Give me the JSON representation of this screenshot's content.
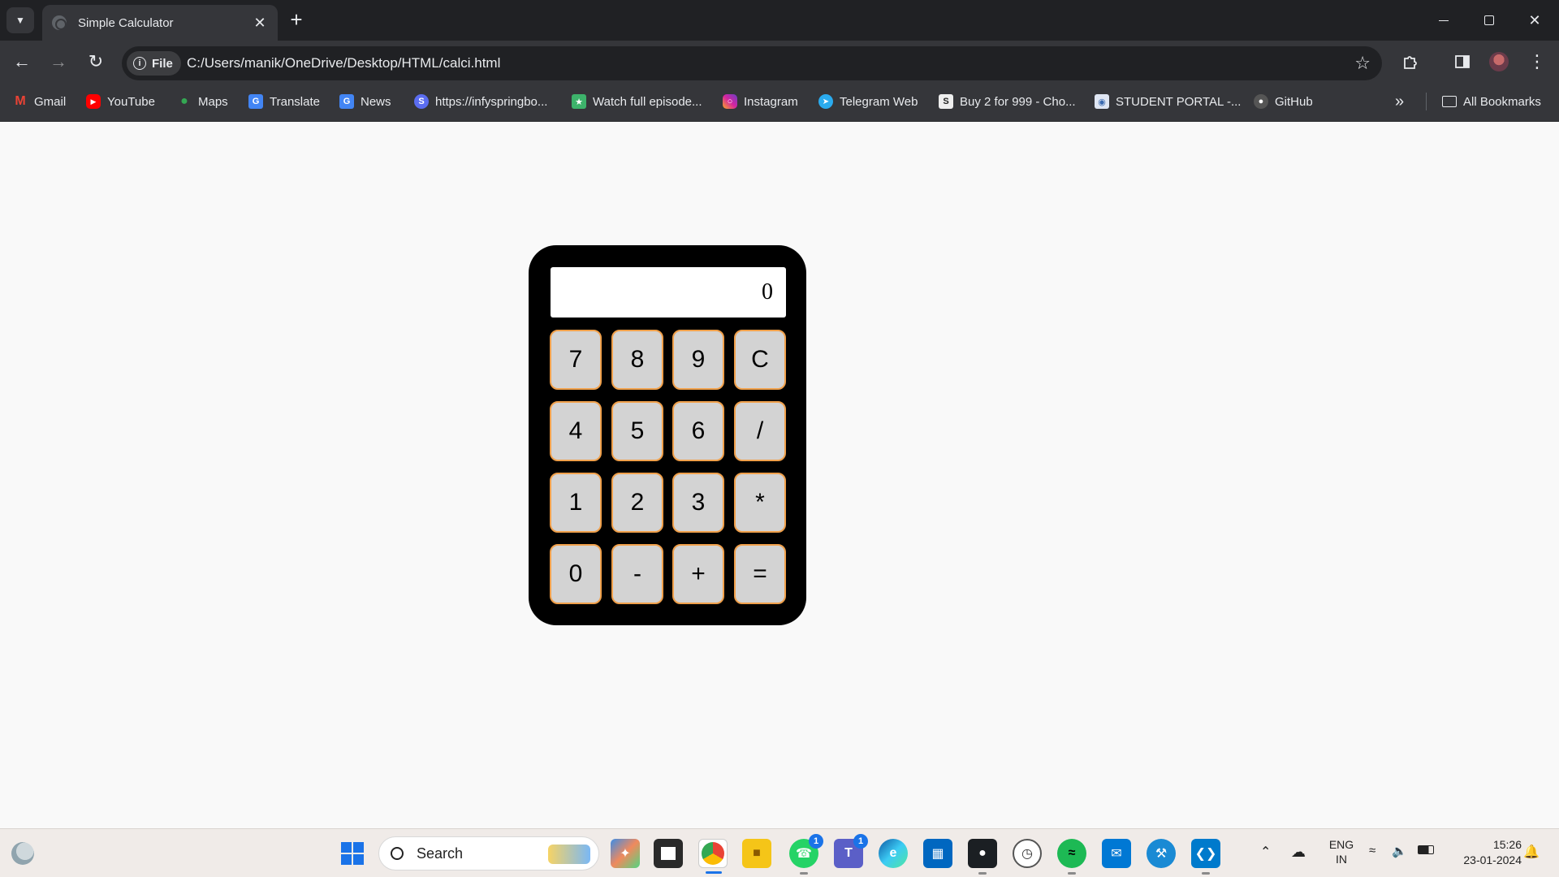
{
  "browser": {
    "tab_title": "Simple Calculator",
    "chip_label": "File",
    "url": "C:/Users/manik/OneDrive/Desktop/HTML/calci.html",
    "bookmarks": [
      {
        "label": "Gmail",
        "icon": "gmail-icon",
        "color": "#ea4335"
      },
      {
        "label": "YouTube",
        "icon": "youtube-icon",
        "color": "#ff0000"
      },
      {
        "label": "Maps",
        "icon": "maps-pin-icon",
        "color": "#34a853"
      },
      {
        "label": "Translate",
        "icon": "translate-icon",
        "color": "#4285f4"
      },
      {
        "label": "News",
        "icon": "news-icon",
        "color": "#4285f4"
      },
      {
        "label": "https://infyspringbo...",
        "icon": "infy-icon",
        "color": "#5b6df0"
      },
      {
        "label": "Watch full episode...",
        "icon": "hotstar-icon",
        "color": "#3db36b"
      },
      {
        "label": "Instagram",
        "icon": "instagram-icon",
        "color": "#d6249f"
      },
      {
        "label": "Telegram Web",
        "icon": "telegram-icon",
        "color": "#2aabee"
      },
      {
        "label": "Buy 2 for 999 - Cho...",
        "icon": "shop-icon",
        "color": "#444444"
      },
      {
        "label": "STUDENT PORTAL -...",
        "icon": "portal-icon",
        "color": "#3a6ab0"
      },
      {
        "label": "GitHub",
        "icon": "github-icon",
        "color": "#555555"
      }
    ],
    "all_bookmarks_label": "All Bookmarks"
  },
  "calculator": {
    "display_value": "0",
    "keys": [
      "7",
      "8",
      "9",
      "C",
      "4",
      "5",
      "6",
      "/",
      "1",
      "2",
      "3",
      "*",
      "0",
      "-",
      "+",
      "="
    ]
  },
  "taskbar": {
    "search_label": "Search",
    "whatsapp_badge": "1",
    "teams_badge": "1",
    "lang_top": "ENG",
    "lang_bottom": "IN",
    "time": "15:26",
    "date": "23-01-2024"
  },
  "colors": {
    "calc_body": "#000000",
    "key_fill": "#d3d3d3",
    "key_border": "#f0a04b"
  }
}
